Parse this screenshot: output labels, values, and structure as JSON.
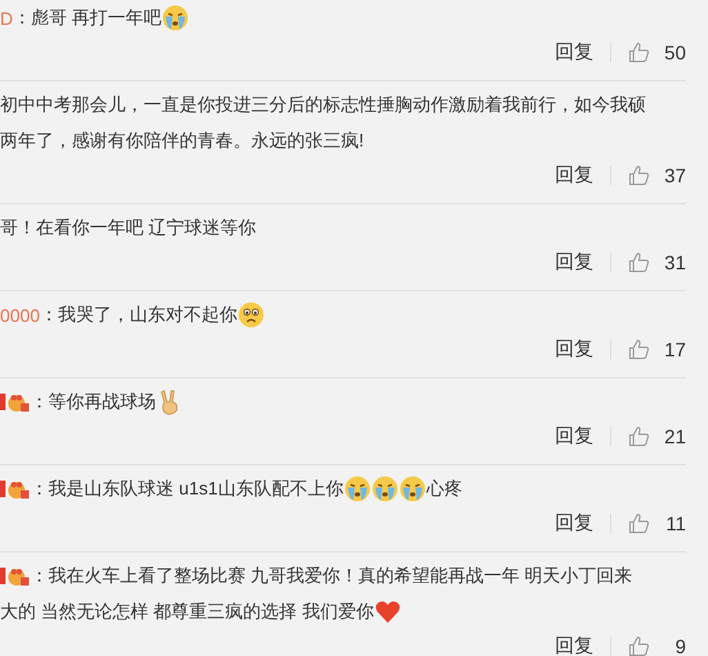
{
  "comments": [
    {
      "lines": [
        [
          {
            "kind": "user",
            "text": "D"
          },
          {
            "kind": "text",
            "text": "：彪哥 再打一年吧"
          },
          {
            "kind": "cry"
          }
        ]
      ],
      "reply": "回复",
      "likes": "50"
    },
    {
      "lines": [
        [
          {
            "kind": "text",
            "text": "初中中考那会儿，一直是你投进三分后的标志性捶胸动作激励着我前行，如今我硕"
          }
        ],
        [
          {
            "kind": "text",
            "text": "两年了，感谢有你陪伴的青春。永远的张三疯!"
          }
        ]
      ],
      "reply": "回复",
      "likes": "37"
    },
    {
      "lines": [
        [
          {
            "kind": "text",
            "text": " 哥！在看你一年吧 辽宁球迷等你"
          }
        ]
      ],
      "reply": "回复",
      "likes": "31"
    },
    {
      "lines": [
        [
          {
            "kind": "user",
            "text": "0000"
          },
          {
            "kind": "text",
            "text": "：我哭了，山东对不起你"
          },
          {
            "kind": "sad"
          }
        ]
      ],
      "reply": "回复",
      "likes": "17"
    },
    {
      "lines": [
        [
          {
            "kind": "badge"
          },
          {
            "kind": "text",
            "text": "：等你再战球场"
          },
          {
            "kind": "victory"
          }
        ]
      ],
      "reply": "回复",
      "likes": "21"
    },
    {
      "lines": [
        [
          {
            "kind": "badge"
          },
          {
            "kind": "text",
            "text": "：我是山东队球迷  u1s1山东队配不上你"
          },
          {
            "kind": "cry"
          },
          {
            "kind": "cry"
          },
          {
            "kind": "cry"
          },
          {
            "kind": "text",
            "text": "心疼"
          }
        ]
      ],
      "reply": "回复",
      "likes": "11"
    },
    {
      "lines": [
        [
          {
            "kind": "badge"
          },
          {
            "kind": "text",
            "text": "：我在火车上看了整场比赛 九哥我爱你！真的希望能再战一年 明天小丁回来"
          }
        ],
        [
          {
            "kind": "text",
            "text": "大的  当然无论怎样 都尊重三疯的选择 我们爱你 "
          },
          {
            "kind": "heart"
          }
        ]
      ],
      "reply": "回复",
      "likes": "9"
    }
  ]
}
